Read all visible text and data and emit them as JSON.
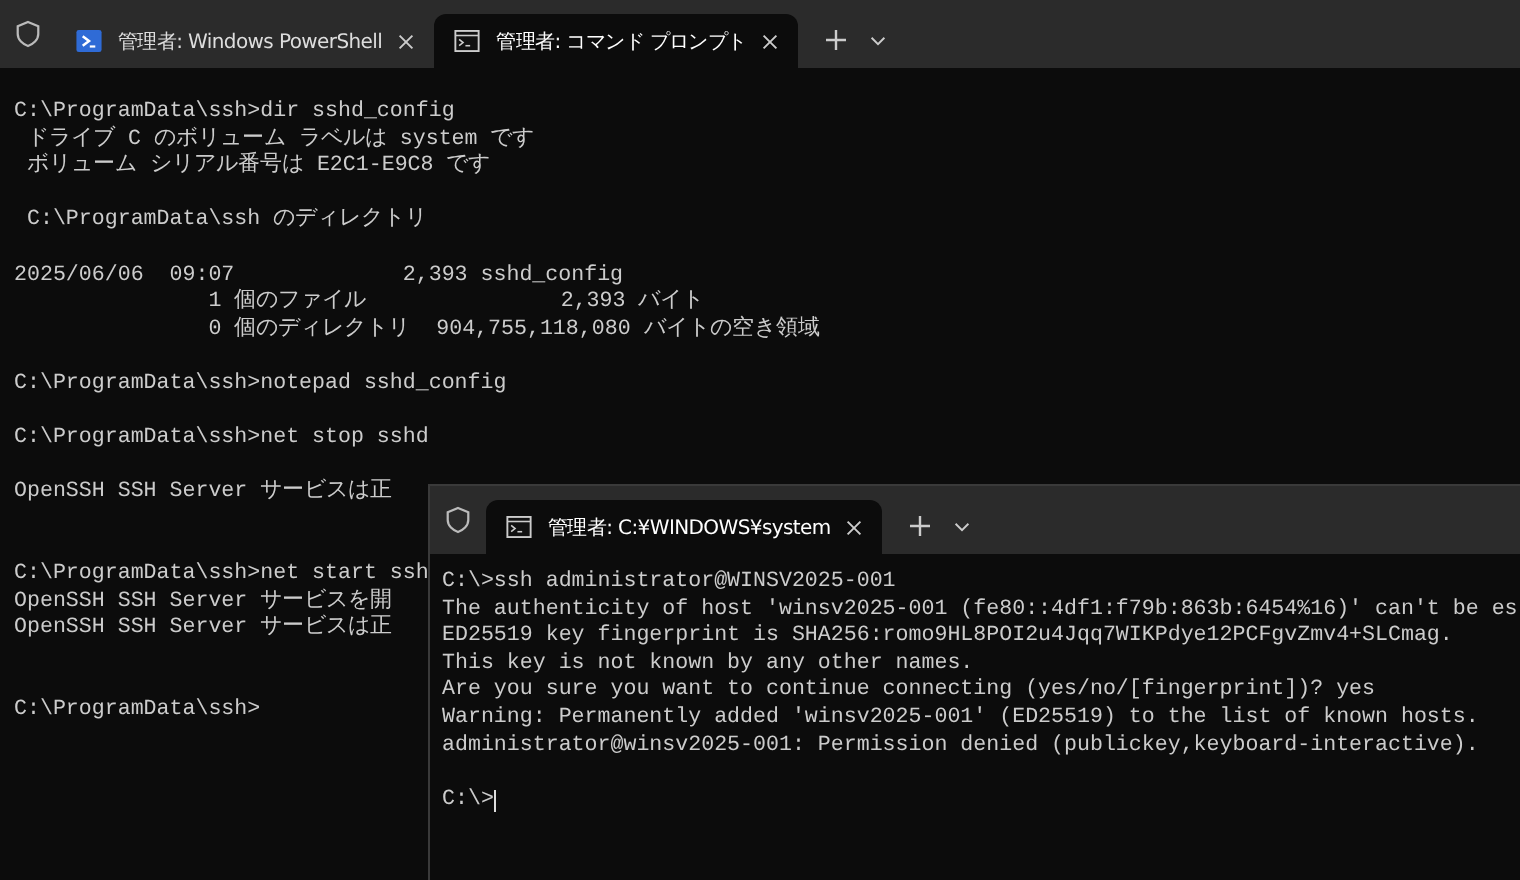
{
  "windows": [
    {
      "tabs": [
        {
          "title": "管理者: Windows PowerShell",
          "kind": "powershell",
          "selected": false
        },
        {
          "title": "管理者: コマンド プロンプト",
          "kind": "cmd",
          "selected": true
        }
      ],
      "lines": [
        {
          "kind": "text",
          "text": "C:\\ProgramData\\ssh>dir sshd_config"
        },
        {
          "kind": "text",
          "text": " ドライブ C のボリューム ラベルは system です"
        },
        {
          "kind": "text",
          "text": " ボリューム シリアル番号は E2C1-E9C8 です"
        },
        {
          "kind": "blank"
        },
        {
          "kind": "text",
          "text": " C:\\ProgramData\\ssh のディレクトリ"
        },
        {
          "kind": "blank"
        },
        {
          "kind": "text",
          "text": "2025/06/06  09:07             2,393 sshd_config"
        },
        {
          "kind": "text",
          "text": "               1 個のファイル               2,393 バイト"
        },
        {
          "kind": "text",
          "text": "               0 個のディレクトリ  904,755,118,080 バイトの空き領域"
        },
        {
          "kind": "blank"
        },
        {
          "kind": "text",
          "text": "C:\\ProgramData\\ssh>notepad sshd_config"
        },
        {
          "kind": "blank"
        },
        {
          "kind": "text",
          "text": "C:\\ProgramData\\ssh>net stop sshd"
        },
        {
          "kind": "blank"
        },
        {
          "kind": "text",
          "text": "OpenSSH SSH Server サービスは正"
        },
        {
          "kind": "blank"
        },
        {
          "kind": "blank"
        },
        {
          "kind": "text",
          "text": "C:\\ProgramData\\ssh>net start ssh"
        },
        {
          "kind": "text",
          "text": "OpenSSH SSH Server サービスを開"
        },
        {
          "kind": "text",
          "text": "OpenSSH SSH Server サービスは正"
        },
        {
          "kind": "blank"
        },
        {
          "kind": "blank"
        },
        {
          "kind": "text",
          "text": "C:\\ProgramData\\ssh>"
        }
      ],
      "cursor": false
    },
    {
      "tabs": [
        {
          "title": "管理者: C:¥WINDOWS¥system",
          "kind": "cmd",
          "selected": true
        }
      ],
      "lines": [
        {
          "kind": "text",
          "text": "C:\\>ssh administrator@WINSV2025-001"
        },
        {
          "kind": "text",
          "text": "The authenticity of host 'winsv2025-001 (fe80::4df1:f79b:863b:6454%16)' can't be es"
        },
        {
          "kind": "text",
          "text": "ED25519 key fingerprint is SHA256:romo9HL8POI2u4Jqq7WIKPdye12PCFgvZmv4+SLCmag."
        },
        {
          "kind": "text",
          "text": "This key is not known by any other names."
        },
        {
          "kind": "text",
          "text": "Are you sure you want to continue connecting (yes/no/[fingerprint])? yes"
        },
        {
          "kind": "text",
          "text": "Warning: Permanently added 'winsv2025-001' (ED25519) to the list of known hosts."
        },
        {
          "kind": "text",
          "text": "administrator@winsv2025-001: Permission denied (publickey,keyboard-interactive)."
        },
        {
          "kind": "blank"
        },
        {
          "kind": "text",
          "text": "C:\\>"
        }
      ],
      "cursor": true
    }
  ]
}
